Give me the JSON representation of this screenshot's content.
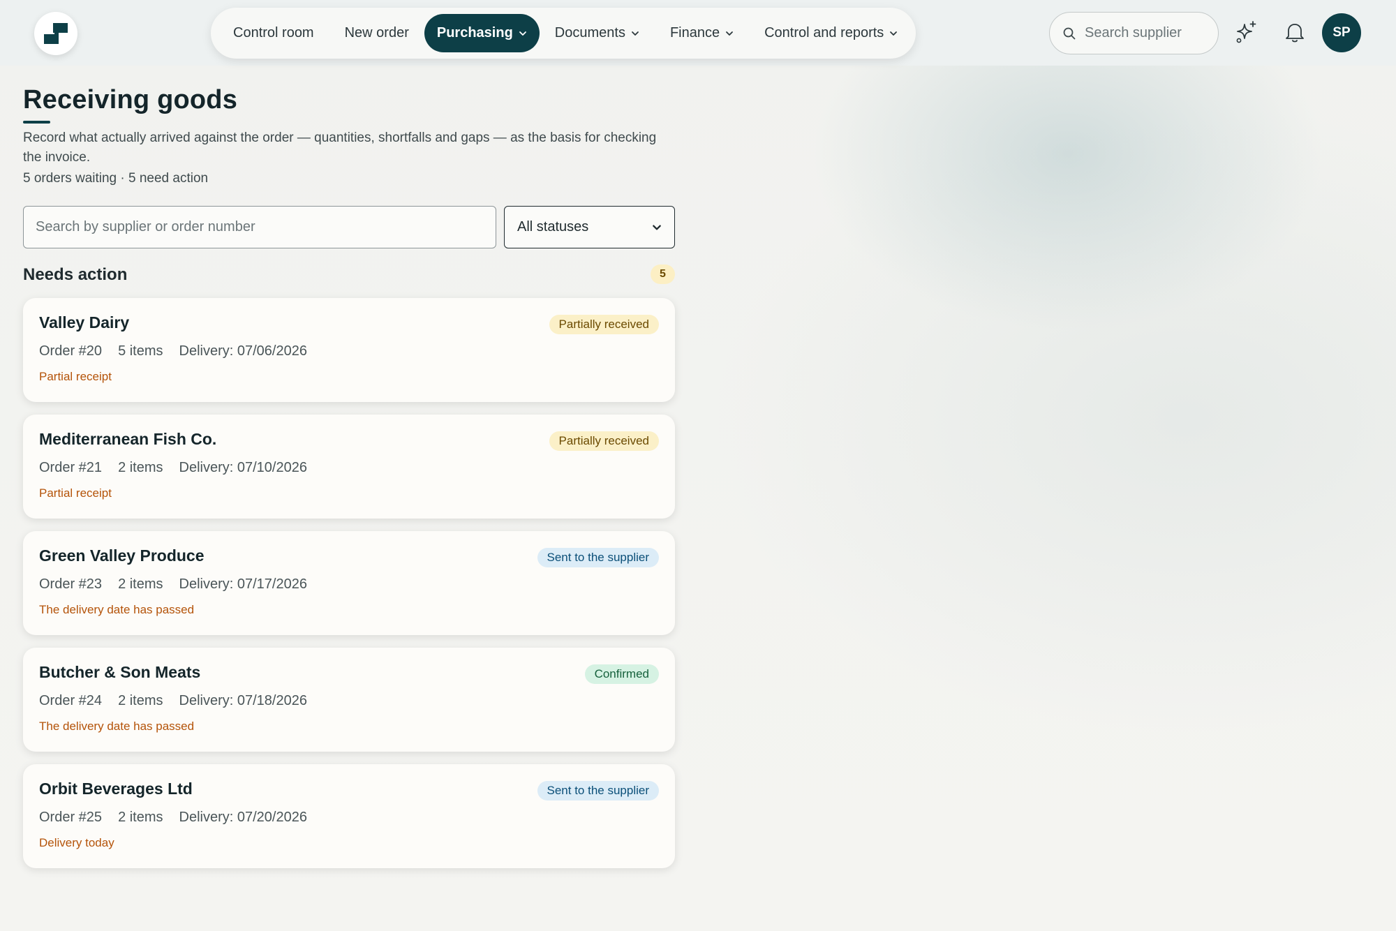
{
  "nav": {
    "items": [
      {
        "label": "Control room",
        "dropdown": false,
        "active": false
      },
      {
        "label": "New order",
        "dropdown": false,
        "active": false
      },
      {
        "label": "Purchasing",
        "dropdown": true,
        "active": true
      },
      {
        "label": "Documents",
        "dropdown": true,
        "active": false
      },
      {
        "label": "Finance",
        "dropdown": true,
        "active": false
      },
      {
        "label": "Control and reports",
        "dropdown": true,
        "active": false
      }
    ]
  },
  "header": {
    "search_placeholder": "Search supplier",
    "avatar_initials": "SP",
    "icons": [
      "sparkles-icon",
      "bell-icon"
    ]
  },
  "page": {
    "title": "Receiving goods",
    "description": "Record what actually arrived against the order — quantities, shortfalls and gaps — as the basis for checking the invoice.",
    "summary": "5 orders waiting · 5 need action"
  },
  "filters": {
    "search_placeholder": "Search by supplier or order number",
    "status_selected": "All statuses"
  },
  "section": {
    "title": "Needs action",
    "count": "5"
  },
  "orders": [
    {
      "supplier": "Valley Dairy",
      "status": "Partially received",
      "status_kind": "partial",
      "order": "Order #20",
      "items": "5 items",
      "delivery": "Delivery: 07/06/2026",
      "note": "Partial receipt"
    },
    {
      "supplier": "Mediterranean Fish Co.",
      "status": "Partially received",
      "status_kind": "partial",
      "order": "Order #21",
      "items": "2 items",
      "delivery": "Delivery: 07/10/2026",
      "note": "Partial receipt"
    },
    {
      "supplier": "Green Valley Produce",
      "status": "Sent to the supplier",
      "status_kind": "sent",
      "order": "Order #23",
      "items": "2 items",
      "delivery": "Delivery: 07/17/2026",
      "note": "The delivery date has passed"
    },
    {
      "supplier": "Butcher & Son Meats",
      "status": "Confirmed",
      "status_kind": "confirmed",
      "order": "Order #24",
      "items": "2 items",
      "delivery": "Delivery: 07/18/2026",
      "note": "The delivery date has passed"
    },
    {
      "supplier": "Orbit Beverages Ltd",
      "status": "Sent to the supplier",
      "status_kind": "sent",
      "order": "Order #25",
      "items": "2 items",
      "delivery": "Delivery: 07/20/2026",
      "note": "Delivery today"
    }
  ],
  "colors": {
    "brand": "#0d3f47",
    "note": "#b45309",
    "badge_partial_bg": "#fbf0c8",
    "badge_sent_bg": "#dcecf7",
    "badge_confirmed_bg": "#d6f2e3"
  }
}
